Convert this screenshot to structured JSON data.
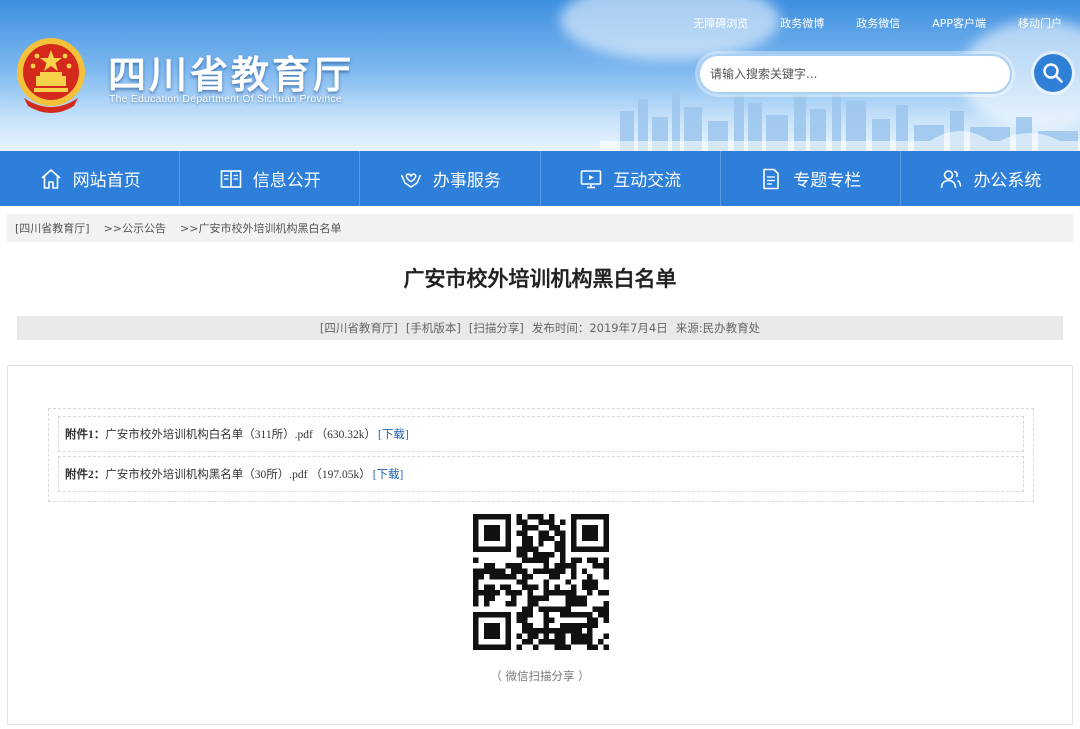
{
  "header": {
    "title": "四川省教育厅",
    "subtitle": "The Education Department Of Sichuan Province",
    "top_links": [
      "无障碍浏览",
      "政务微博",
      "政务微信",
      "APP客户端",
      "移动门户"
    ],
    "search_placeholder": "请输入搜索关键字..."
  },
  "nav": {
    "items": [
      {
        "label": "网站首页",
        "icon": "home-icon"
      },
      {
        "label": "信息公开",
        "icon": "book-icon"
      },
      {
        "label": "办事服务",
        "icon": "hands-heart-icon"
      },
      {
        "label": "互动交流",
        "icon": "monitor-icon"
      },
      {
        "label": "专题专栏",
        "icon": "document-icon"
      },
      {
        "label": "办公系统",
        "icon": "users-icon"
      }
    ]
  },
  "breadcrumb": {
    "items": [
      "[四川省教育厅]",
      ">>公示公告",
      ">>广安市校外培训机构黑白名单"
    ]
  },
  "article": {
    "title": "广安市校外培训机构黑白名单",
    "meta": {
      "source_link": "[四川省教育厅]",
      "mobile_link": "[手机版本]",
      "scan_link": "[扫描分享]",
      "publish_time": "发布时间：2019年7月4日",
      "origin": "来源:民办教育处"
    },
    "attachments": [
      {
        "label": "附件1：",
        "name": "广安市校外培训机构白名单（311所）.pdf （630.32k）",
        "download": "[下载]"
      },
      {
        "label": "附件2：",
        "name": "广安市校外培训机构黑名单（30所）.pdf （197.05k）",
        "download": "[下载]"
      }
    ],
    "qr_caption": "（ 微信扫描分享 ）"
  },
  "colors": {
    "nav_bg": "#2d7fda",
    "header_sky": "#3e8fe0",
    "link_blue": "#1f5fb0"
  }
}
